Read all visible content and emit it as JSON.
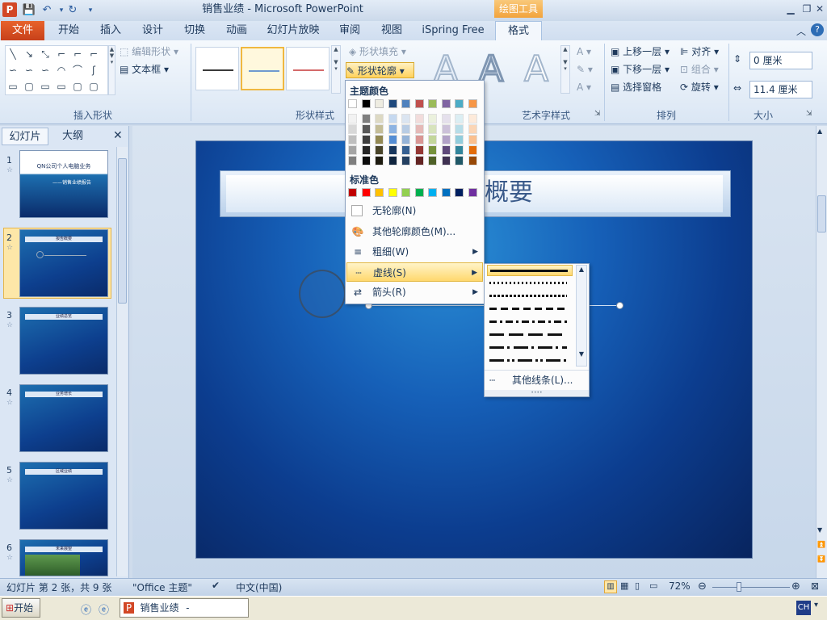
{
  "window": {
    "title": "销售业绩 - Microsoft PowerPoint",
    "context_tab": "绘图工具"
  },
  "tabs": [
    "文件",
    "开始",
    "插入",
    "设计",
    "切换",
    "动画",
    "幻灯片放映",
    "审阅",
    "视图",
    "iSpring Free",
    "格式"
  ],
  "ribbon": {
    "insert_shapes": {
      "label": "插入形状",
      "edit_shape": "编辑形状",
      "text_box": "文本框"
    },
    "shape_styles": {
      "label": "形状样式",
      "fill": "形状填充",
      "outline": "形状轮廓"
    },
    "wordart": {
      "label": "艺术字样式"
    },
    "arrange": {
      "label": "排列",
      "bring_forward": "上移一层",
      "send_backward": "下移一层",
      "selection_pane": "选择窗格",
      "align": "对齐",
      "group": "组合",
      "rotate": "旋转"
    },
    "size": {
      "label": "大小",
      "height": "0 厘米",
      "width": "11.4 厘米"
    }
  },
  "left_panel": {
    "tab_slides": "幻灯片",
    "tab_outline": "大纲",
    "slides": [
      {
        "num": "1",
        "title": "QN公司个人电脑业务",
        "subtitle": "——销售业绩报告"
      },
      {
        "num": "2",
        "title": "报告概要"
      },
      {
        "num": "3",
        "title": "业绩总览"
      },
      {
        "num": "4",
        "title": "业务增长"
      },
      {
        "num": "5",
        "title": "区域业绩"
      },
      {
        "num": "6",
        "title": "未来展望"
      }
    ]
  },
  "slide": {
    "title": "概要"
  },
  "outline_menu": {
    "theme_colors": "主题颜色",
    "standard_colors": "标准色",
    "no_outline": "无轮廓(N)",
    "more_colors": "其他轮廓颜色(M)...",
    "weight": "粗细(W)",
    "dashes": "虚线(S)",
    "arrows": "箭头(R)",
    "theme_top": [
      "#ffffff",
      "#000000",
      "#eeece1",
      "#1f497d",
      "#4f81bd",
      "#c0504d",
      "#9bbb59",
      "#8064a2",
      "#4bacc6",
      "#f79646"
    ],
    "theme_shades": [
      [
        "#f2f2f2",
        "#d8d8d8",
        "#bfbfbf",
        "#a5a5a5",
        "#7f7f7f"
      ],
      [
        "#7f7f7f",
        "#595959",
        "#3f3f3f",
        "#262626",
        "#0c0c0c"
      ],
      [
        "#ddd9c3",
        "#c4bd97",
        "#938953",
        "#494429",
        "#1d1b10"
      ],
      [
        "#c6d9f0",
        "#8db3e2",
        "#548dd4",
        "#17365d",
        "#0f243e"
      ],
      [
        "#dbe5f1",
        "#b8cce4",
        "#95b3d7",
        "#366092",
        "#244061"
      ],
      [
        "#f2dcdb",
        "#e5b9b7",
        "#d99694",
        "#953734",
        "#632423"
      ],
      [
        "#ebf1dd",
        "#d7e3bc",
        "#c3d69b",
        "#76923c",
        "#4f6128"
      ],
      [
        "#e5e0ec",
        "#ccc1d9",
        "#b2a2c7",
        "#5f497a",
        "#3f3151"
      ],
      [
        "#dbeef3",
        "#b7dde8",
        "#92cddc",
        "#31859b",
        "#205867"
      ],
      [
        "#fdeada",
        "#fbd5b5",
        "#fac08f",
        "#e36c09",
        "#974806"
      ]
    ],
    "standard": [
      "#c00000",
      "#ff0000",
      "#ffc000",
      "#ffff00",
      "#92d050",
      "#00b050",
      "#00b0f0",
      "#0070c0",
      "#002060",
      "#7030a0"
    ]
  },
  "dash_submenu": {
    "more_lines": "其他线条(L)..."
  },
  "status": {
    "slide_info": "幻灯片 第 2 张，共 9 张",
    "theme": "\"Office 主题\"",
    "language": "中文(中国)",
    "zoom": "72%"
  },
  "taskbar": {
    "start": "开始",
    "task": "销售业绩 - Microsof...",
    "ime": "CH"
  }
}
